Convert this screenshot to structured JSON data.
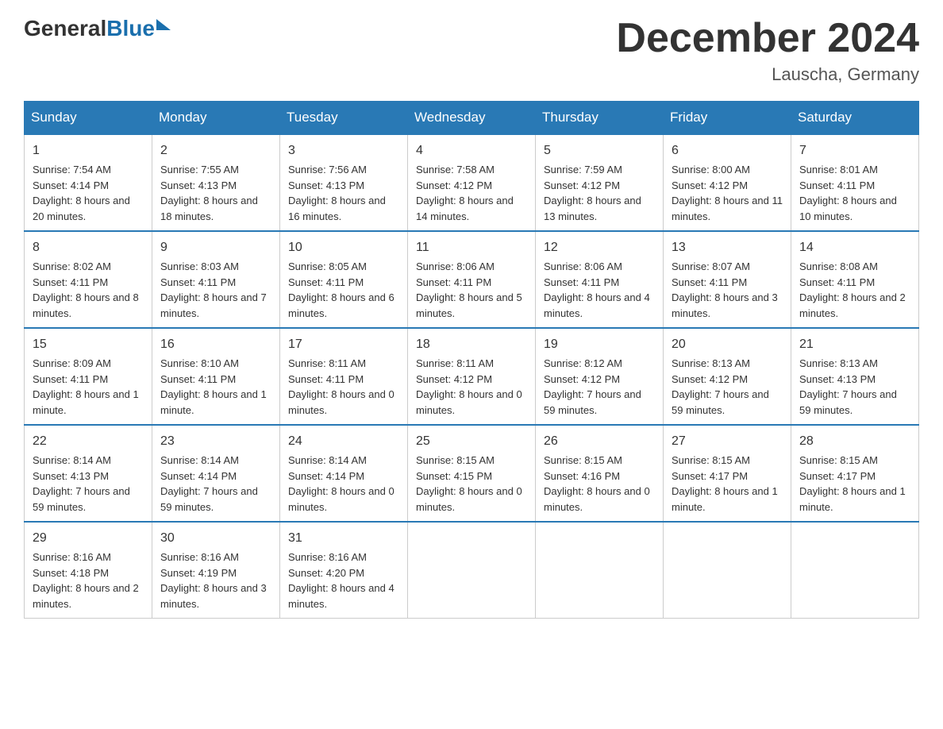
{
  "logo": {
    "general": "General",
    "blue": "Blue"
  },
  "title": {
    "month_year": "December 2024",
    "location": "Lauscha, Germany"
  },
  "days_of_week": [
    "Sunday",
    "Monday",
    "Tuesday",
    "Wednesday",
    "Thursday",
    "Friday",
    "Saturday"
  ],
  "weeks": [
    [
      {
        "day": "1",
        "sunrise": "7:54 AM",
        "sunset": "4:14 PM",
        "daylight": "8 hours and 20 minutes."
      },
      {
        "day": "2",
        "sunrise": "7:55 AM",
        "sunset": "4:13 PM",
        "daylight": "8 hours and 18 minutes."
      },
      {
        "day": "3",
        "sunrise": "7:56 AM",
        "sunset": "4:13 PM",
        "daylight": "8 hours and 16 minutes."
      },
      {
        "day": "4",
        "sunrise": "7:58 AM",
        "sunset": "4:12 PM",
        "daylight": "8 hours and 14 minutes."
      },
      {
        "day": "5",
        "sunrise": "7:59 AM",
        "sunset": "4:12 PM",
        "daylight": "8 hours and 13 minutes."
      },
      {
        "day": "6",
        "sunrise": "8:00 AM",
        "sunset": "4:12 PM",
        "daylight": "8 hours and 11 minutes."
      },
      {
        "day": "7",
        "sunrise": "8:01 AM",
        "sunset": "4:11 PM",
        "daylight": "8 hours and 10 minutes."
      }
    ],
    [
      {
        "day": "8",
        "sunrise": "8:02 AM",
        "sunset": "4:11 PM",
        "daylight": "8 hours and 8 minutes."
      },
      {
        "day": "9",
        "sunrise": "8:03 AM",
        "sunset": "4:11 PM",
        "daylight": "8 hours and 7 minutes."
      },
      {
        "day": "10",
        "sunrise": "8:05 AM",
        "sunset": "4:11 PM",
        "daylight": "8 hours and 6 minutes."
      },
      {
        "day": "11",
        "sunrise": "8:06 AM",
        "sunset": "4:11 PM",
        "daylight": "8 hours and 5 minutes."
      },
      {
        "day": "12",
        "sunrise": "8:06 AM",
        "sunset": "4:11 PM",
        "daylight": "8 hours and 4 minutes."
      },
      {
        "day": "13",
        "sunrise": "8:07 AM",
        "sunset": "4:11 PM",
        "daylight": "8 hours and 3 minutes."
      },
      {
        "day": "14",
        "sunrise": "8:08 AM",
        "sunset": "4:11 PM",
        "daylight": "8 hours and 2 minutes."
      }
    ],
    [
      {
        "day": "15",
        "sunrise": "8:09 AM",
        "sunset": "4:11 PM",
        "daylight": "8 hours and 1 minute."
      },
      {
        "day": "16",
        "sunrise": "8:10 AM",
        "sunset": "4:11 PM",
        "daylight": "8 hours and 1 minute."
      },
      {
        "day": "17",
        "sunrise": "8:11 AM",
        "sunset": "4:11 PM",
        "daylight": "8 hours and 0 minutes."
      },
      {
        "day": "18",
        "sunrise": "8:11 AM",
        "sunset": "4:12 PM",
        "daylight": "8 hours and 0 minutes."
      },
      {
        "day": "19",
        "sunrise": "8:12 AM",
        "sunset": "4:12 PM",
        "daylight": "7 hours and 59 minutes."
      },
      {
        "day": "20",
        "sunrise": "8:13 AM",
        "sunset": "4:12 PM",
        "daylight": "7 hours and 59 minutes."
      },
      {
        "day": "21",
        "sunrise": "8:13 AM",
        "sunset": "4:13 PM",
        "daylight": "7 hours and 59 minutes."
      }
    ],
    [
      {
        "day": "22",
        "sunrise": "8:14 AM",
        "sunset": "4:13 PM",
        "daylight": "7 hours and 59 minutes."
      },
      {
        "day": "23",
        "sunrise": "8:14 AM",
        "sunset": "4:14 PM",
        "daylight": "7 hours and 59 minutes."
      },
      {
        "day": "24",
        "sunrise": "8:14 AM",
        "sunset": "4:14 PM",
        "daylight": "8 hours and 0 minutes."
      },
      {
        "day": "25",
        "sunrise": "8:15 AM",
        "sunset": "4:15 PM",
        "daylight": "8 hours and 0 minutes."
      },
      {
        "day": "26",
        "sunrise": "8:15 AM",
        "sunset": "4:16 PM",
        "daylight": "8 hours and 0 minutes."
      },
      {
        "day": "27",
        "sunrise": "8:15 AM",
        "sunset": "4:17 PM",
        "daylight": "8 hours and 1 minute."
      },
      {
        "day": "28",
        "sunrise": "8:15 AM",
        "sunset": "4:17 PM",
        "daylight": "8 hours and 1 minute."
      }
    ],
    [
      {
        "day": "29",
        "sunrise": "8:16 AM",
        "sunset": "4:18 PM",
        "daylight": "8 hours and 2 minutes."
      },
      {
        "day": "30",
        "sunrise": "8:16 AM",
        "sunset": "4:19 PM",
        "daylight": "8 hours and 3 minutes."
      },
      {
        "day": "31",
        "sunrise": "8:16 AM",
        "sunset": "4:20 PM",
        "daylight": "8 hours and 4 minutes."
      },
      null,
      null,
      null,
      null
    ]
  ],
  "labels": {
    "sunrise": "Sunrise:",
    "sunset": "Sunset:",
    "daylight": "Daylight:"
  }
}
